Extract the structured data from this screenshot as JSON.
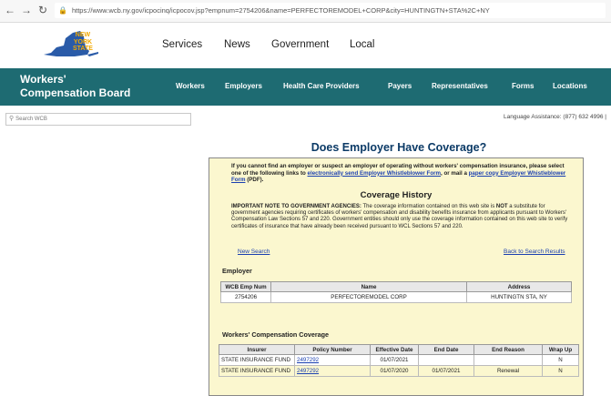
{
  "browser": {
    "url": "https://www.wcb.ny.gov/icpocinq/icpocov.jsp?empnum=2754206&name=PERFECTOREMODEL+CORP&city=HUNTINGTN+STA%2C+NY",
    "back_icon": "back-arrow-icon",
    "forward_icon": "forward-arrow-icon",
    "reload_icon": "reload-icon",
    "lock_icon": "lock-icon"
  },
  "header": {
    "logo_text": [
      "NEW",
      "YORK",
      "STATE"
    ],
    "nav": [
      "Services",
      "News",
      "Government",
      "Local"
    ]
  },
  "agency_bar": {
    "brand_line1": "Workers'",
    "brand_line2": "Compensation Board",
    "nav": [
      "Workers",
      "Employers",
      "Health Care Providers",
      "Payers",
      "Representatives",
      "Forms",
      "Locations"
    ]
  },
  "search": {
    "placeholder": "Search WCB"
  },
  "language_assistance": "Language Assistance: (877) 632 4996 |",
  "page_title": "Does Employer Have Coverage?",
  "intro": {
    "text1": "If you cannot find an employer or suspect an employer of operating without workers' compensation insurance, please select one of the following links to ",
    "link1": "electronically send Employer Whistleblower Form",
    "text2": ", or mail a ",
    "link2": "paper copy Employer Whistleblower Form",
    "text3": " (PDF)."
  },
  "coverage_history_title": "Coverage History",
  "important": {
    "label": "IMPORTANT NOTE TO GOVERNMENT AGENCIES:",
    "text_a": " The coverage information contained on this web site is ",
    "not_word": "NOT",
    "text_b": " a substitute for government agencies requiring certificates of workers' compensation and disability benefits insurance from applicants pursuant to Workers' Compensation Law Sections 57 and 220. Government entities should only use the coverage information contained on this web site to verify certificates of insurance that have already been received pursuant to WCL Sections 57 and 220."
  },
  "links": {
    "new_search": "New Search",
    "back_to_results": "Back to Search Results"
  },
  "employer": {
    "section_label": "Employer",
    "headers": [
      "WCB Emp Num",
      "Name",
      "Address"
    ],
    "row": [
      "2754206",
      "PERFECTOREMODEL CORP",
      "HUNTINGTN STA, NY"
    ]
  },
  "wc_coverage": {
    "section_label": "Workers' Compensation Coverage",
    "headers": [
      "Insurer",
      "Policy Number",
      "Effective Date",
      "End Date",
      "End Reason",
      "Wrap Up"
    ],
    "rows": [
      [
        "STATE INSURANCE FUND",
        "2497292",
        "01/07/2021",
        "",
        "",
        "N"
      ],
      [
        "STATE INSURANCE FUND",
        "2497292",
        "01/07/2020",
        "01/07/2021",
        "Renewal",
        "N"
      ]
    ]
  },
  "colors": {
    "agency_green": "#1e6b72",
    "panel_yellow": "#fbf7cf",
    "title_blue": "#0b3a66",
    "link_blue": "#1a3fb0"
  }
}
